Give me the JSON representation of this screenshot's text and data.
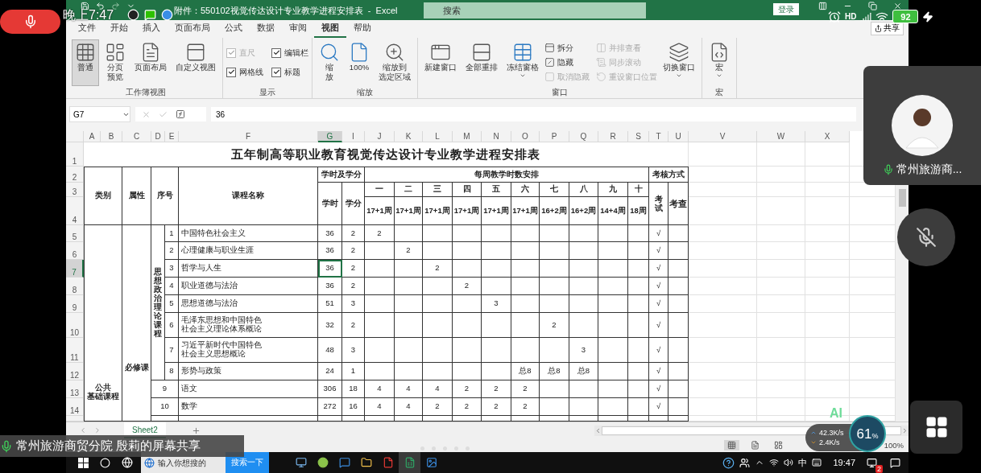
{
  "phone": {
    "time": "晚上7:47",
    "network": "HD",
    "battery": "92"
  },
  "excel": {
    "title": "附件：550102视觉传达设计专业教学进程安排表  -  Excel",
    "search_placeholder": "搜索",
    "sign_in": "登录",
    "share": "共享",
    "tabs": [
      {
        "label": "文件",
        "selected": false
      },
      {
        "label": "开始",
        "selected": false
      },
      {
        "label": "插入",
        "selected": false
      },
      {
        "label": "页面布局",
        "selected": false
      },
      {
        "label": "公式",
        "selected": false
      },
      {
        "label": "数据",
        "selected": false
      },
      {
        "label": "审阅",
        "selected": false
      },
      {
        "label": "视图",
        "selected": true
      },
      {
        "label": "帮助",
        "selected": false
      }
    ],
    "ribbon": [
      {
        "name": "工作簿视图",
        "items": [
          {
            "kind": "large",
            "label": "普通",
            "selected": true
          },
          {
            "kind": "large",
            "lines": [
              "分页",
              "预览"
            ],
            "selected": false
          },
          {
            "kind": "large",
            "label": "页面布局",
            "selected": false
          },
          {
            "kind": "large",
            "label": "自定义视图",
            "selected": false
          }
        ]
      },
      {
        "name": "显示",
        "items": [
          {
            "kind": "check",
            "label": "直尺",
            "checked": true,
            "disabled": true
          },
          {
            "kind": "check",
            "label": "网格线",
            "checked": true,
            "disabled": false
          },
          {
            "kind": "check",
            "label": "编辑栏",
            "checked": true,
            "disabled": false
          },
          {
            "kind": "check",
            "label": "标题",
            "checked": true,
            "disabled": false
          }
        ]
      },
      {
        "name": "缩放",
        "items": [
          {
            "kind": "large",
            "lines": [
              "缩",
              "放"
            ],
            "dropdown": false
          },
          {
            "kind": "large",
            "label": "100%",
            "dropdown": false
          },
          {
            "kind": "large",
            "lines": [
              "缩放到",
              "选定区域"
            ],
            "dropdown": false
          }
        ]
      },
      {
        "name": "窗口",
        "items": [
          {
            "kind": "large",
            "label": "新建窗口",
            "dropdown": false
          },
          {
            "kind": "large",
            "label": "全部重排",
            "dropdown": false
          },
          {
            "kind": "large",
            "label": "冻结窗格",
            "dropdown": true
          },
          {
            "kind": "small",
            "label": "拆分",
            "disabled": false
          },
          {
            "kind": "small",
            "label": "隐藏",
            "disabled": false
          },
          {
            "kind": "small",
            "label": "取消隐藏",
            "disabled": true
          },
          {
            "kind": "small",
            "label": "并排查看",
            "disabled": true
          },
          {
            "kind": "small",
            "label": "同步滚动",
            "disabled": true
          },
          {
            "kind": "small",
            "label": "重设窗口位置",
            "disabled": true
          },
          {
            "kind": "large",
            "label": "切换窗口",
            "dropdown": true
          }
        ]
      },
      {
        "name": "宏",
        "items": [
          {
            "kind": "large",
            "label": "宏",
            "dropdown": true
          }
        ]
      }
    ],
    "name_box": "G7",
    "formula": "36",
    "sheet": {
      "title": "五年制高等职业教育视觉传达设计专业教学进程安排表",
      "column_headers": [
        {
          "label": "A",
          "selected": false
        },
        {
          "label": "B",
          "selected": false
        },
        {
          "label": "C",
          "selected": false
        },
        {
          "label": "D",
          "selected": false
        },
        {
          "label": "E",
          "selected": false
        },
        {
          "label": "F",
          "selected": false
        },
        {
          "label": "G",
          "selected": true
        },
        {
          "label": "I",
          "selected": false
        },
        {
          "label": "J",
          "selected": false
        },
        {
          "label": "K",
          "selected": false
        },
        {
          "label": "L",
          "selected": false
        },
        {
          "label": "M",
          "selected": false
        },
        {
          "label": "N",
          "selected": false
        },
        {
          "label": "O",
          "selected": false
        },
        {
          "label": "P",
          "selected": false
        },
        {
          "label": "Q",
          "selected": false
        },
        {
          "label": "R",
          "selected": false
        },
        {
          "label": "S",
          "selected": false
        },
        {
          "label": "T",
          "selected": false
        },
        {
          "label": "U",
          "selected": false
        },
        {
          "label": "V",
          "selected": false
        },
        {
          "label": "W",
          "selected": false
        },
        {
          "label": "X",
          "selected": false
        }
      ],
      "row_numbers": [
        {
          "label": "1",
          "selected": false
        },
        {
          "label": "2",
          "selected": false
        },
        {
          "label": "3",
          "selected": false
        },
        {
          "label": "4",
          "selected": false
        },
        {
          "label": "5",
          "selected": false
        },
        {
          "label": "6",
          "selected": false
        },
        {
          "label": "7",
          "selected": true
        },
        {
          "label": "8",
          "selected": false
        },
        {
          "label": "9",
          "selected": false
        },
        {
          "label": "10",
          "selected": false
        },
        {
          "label": "11",
          "selected": false
        },
        {
          "label": "12",
          "selected": false
        },
        {
          "label": "13",
          "selected": false
        },
        {
          "label": "14",
          "selected": false
        }
      ],
      "header": {
        "category": "类别",
        "attribute": "属性",
        "number": "序号",
        "course_name": "课程名称",
        "hours_credits": "学时及学分",
        "hours": "学时",
        "credits": "学分",
        "weekly": "每周教学时数安排",
        "assessment": "考核方式",
        "exam": "考试",
        "check": "考查",
        "semesters": [
          {
            "label": "一",
            "weeks": "17+1周"
          },
          {
            "label": "二",
            "weeks": "17+1周"
          },
          {
            "label": "三",
            "weeks": "17+1周"
          },
          {
            "label": "四",
            "weeks": "17+1周"
          },
          {
            "label": "五",
            "weeks": "17+1周"
          },
          {
            "label": "六",
            "weeks": "17+1周"
          },
          {
            "label": "七",
            "weeks": "16+2周"
          },
          {
            "label": "八",
            "weeks": "16+2周"
          },
          {
            "label": "九",
            "weeks": "14+4周"
          },
          {
            "label": "十",
            "weeks": "18周"
          }
        ]
      },
      "category": {
        "label_lines": [
          "公共",
          "基础课程"
        ],
        "attribute": "必修课",
        "subgroup": {
          "label": "思想政治理论课程",
          "courses": [
            {
              "no": "1",
              "name": "中国特色社会主义",
              "hours": "36",
              "credits": "2",
              "weekly": {
                "s1": "2"
              },
              "exam": "√",
              "selected": false
            },
            {
              "no": "2",
              "name": "心理健康与职业生涯",
              "hours": "36",
              "credits": "2",
              "weekly": {
                "s2": "2"
              },
              "exam": "√",
              "selected": false
            },
            {
              "no": "3",
              "name": "哲学与人生",
              "hours": "36",
              "credits": "2",
              "weekly": {
                "s3": "2"
              },
              "exam": "√",
              "selected": true
            },
            {
              "no": "4",
              "name": "职业道德与法治",
              "hours": "36",
              "credits": "2",
              "weekly": {
                "s4": "2"
              },
              "exam": "√",
              "selected": false
            },
            {
              "no": "5",
              "name": "思想道德与法治",
              "hours": "51",
              "credits": "3",
              "weekly": {
                "s5": "3"
              },
              "exam": "√",
              "selected": false
            },
            {
              "no": "6",
              "name": "毛泽东思想和中国特色社会主义理论体系概论",
              "hours": "32",
              "credits": "2",
              "weekly": {
                "s7": "2"
              },
              "exam": "√",
              "selected": false
            },
            {
              "no": "7",
              "name": "习近平新时代中国特色社会主义思想概论",
              "hours": "48",
              "credits": "3",
              "weekly": {
                "s8": "3"
              },
              "exam": "√",
              "selected": false
            },
            {
              "no": "8",
              "name": "形势与政策",
              "hours": "24",
              "credits": "1",
              "weekly": {
                "s6": "总8",
                "s7": "总8",
                "s8": "总8"
              },
              "exam": "√",
              "selected": false
            }
          ]
        },
        "courses": [
          {
            "no": "9",
            "name": "语文",
            "hours": "306",
            "credits": "18",
            "weekly": {
              "s1": "4",
              "s2": "4",
              "s3": "4",
              "s4": "2",
              "s5": "2",
              "s6": "2"
            },
            "exam": "√",
            "selected": false
          },
          {
            "no": "10",
            "name": "数学",
            "hours": "272",
            "credits": "16",
            "weekly": {
              "s1": "4",
              "s2": "4",
              "s3": "2",
              "s4": "2",
              "s5": "2",
              "s6": "2"
            },
            "exam": "√",
            "selected": false
          }
        ]
      }
    },
    "sheet_tabs": [
      {
        "label": "Sheet2",
        "selected": true
      }
    ],
    "zoom": "100%"
  },
  "taskbar": {
    "search_placeholder": "输入你想搜的",
    "search_button": "搜索一下",
    "ime": "中",
    "clock": "19:47",
    "notification_count": "2"
  },
  "meeting": {
    "participant": "常州旅游商...",
    "caption": "常州旅游商贸分院 殷莉的屏幕共享",
    "upload": "42.3K/s",
    "download": "2.4K/s",
    "cpu": "61",
    "cpu_unit": "%",
    "ai": "AI"
  }
}
